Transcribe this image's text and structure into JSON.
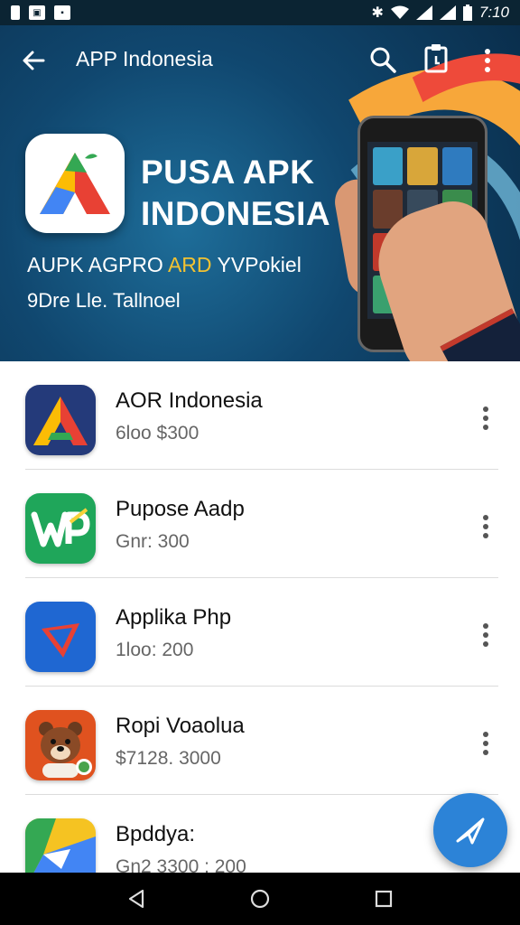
{
  "status_bar": {
    "time": "7:10"
  },
  "app_bar": {
    "title": "APP Indonesia"
  },
  "hero": {
    "title_line1": "PUSA APK",
    "title_line2": "INDONESIA",
    "subtitle_part1": "AUPK AGPRO ",
    "subtitle_highlight": "ARD",
    "subtitle_part2": " YVPokiel",
    "tagline": "9Dre Lle. Tallnoel"
  },
  "apps": [
    {
      "name": "AOR Indonesia",
      "meta": "6loo $300",
      "icon": "triangle-logo-icon"
    },
    {
      "name": "Pupose Aadp",
      "meta": "Gnr: 300",
      "icon": "wp-logo-icon"
    },
    {
      "name": "Applika Php",
      "meta": "1loo: 200",
      "icon": "diamond-logo-icon"
    },
    {
      "name": "Ropi Voaolua",
      "meta": "$7128. 3000",
      "icon": "bear-logo-icon"
    },
    {
      "name": "Bpddya:",
      "meta": "Gn2 3300 : 200",
      "icon": "folded-logo-icon"
    }
  ],
  "colors": {
    "accent": "#2c83d7",
    "status_bar": "#0b2433",
    "hero_bg": "#10476f",
    "highlight": "#f2c232"
  }
}
